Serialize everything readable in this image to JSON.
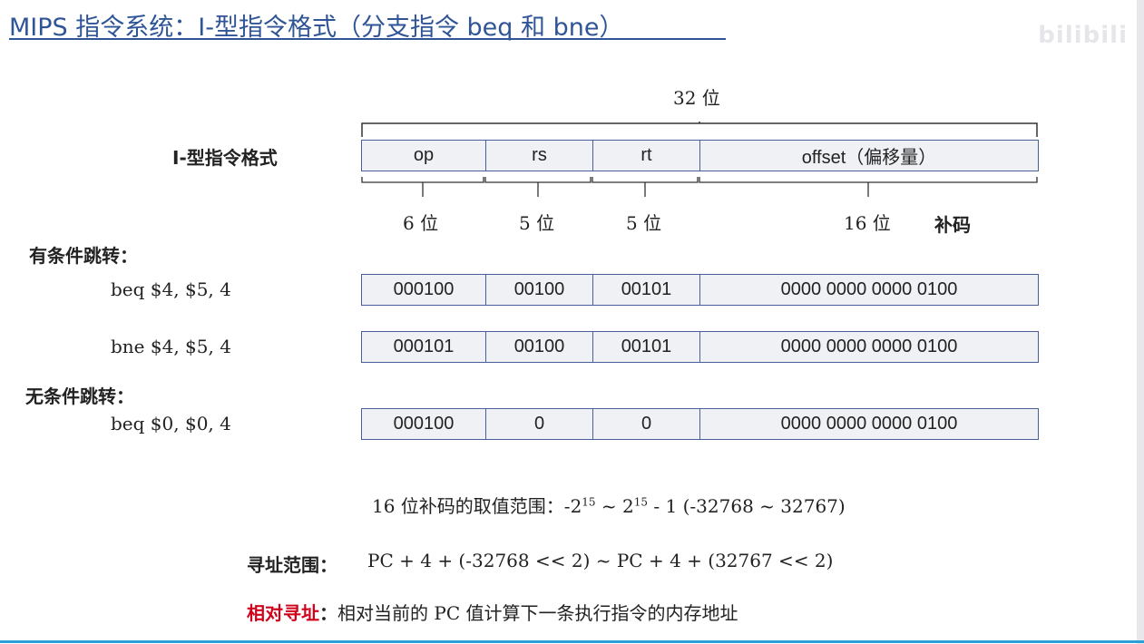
{
  "title": "MIPS 指令系统：I-型指令格式（分支指令 beq 和 bne）",
  "watermark": "bilibili",
  "format": {
    "total_label": "32 位",
    "row_label": "I-型指令格式",
    "fields": [
      "op",
      "rs",
      "rt",
      "offset（偏移量）"
    ],
    "widths": [
      "6 位",
      "5 位",
      "5 位",
      "16 位"
    ],
    "complement_note": "补码"
  },
  "conditional": {
    "heading": "有条件跳转：",
    "rows": [
      {
        "label": "beq $4, $5, 4",
        "cells": [
          "000100",
          "00100",
          "00101",
          "0000 0000 0000 0100"
        ]
      },
      {
        "label": "bne $4, $5, 4",
        "cells": [
          "000101",
          "00100",
          "00101",
          "0000 0000 0000 0100"
        ]
      }
    ]
  },
  "unconditional": {
    "heading": "无条件跳转：",
    "rows": [
      {
        "label": "beq $0, $0, 4",
        "cells": [
          "000100",
          "0",
          "0",
          "0000 0000 0000 0100"
        ]
      }
    ]
  },
  "range_text": {
    "prefix": "16 位补码的取值范围：-2",
    "exp1": "15",
    "mid": " ~ 2",
    "exp2": "15",
    "suffix": " - 1  (-32768 ~ 32767)"
  },
  "addressing": {
    "label": "寻址范围：",
    "value": "PC + 4 + (-32768 << 2) ~ PC + 4 + (32767 << 2)"
  },
  "relative": {
    "label": "相对寻址",
    "sep": "：",
    "value": "相对当前的 PC 值计算下一条执行指令的内存地址"
  },
  "colors": {
    "title": "#2f5597",
    "accent_red": "#d0021b",
    "cell_fill": "#f0f1f5",
    "cell_border": "#4a5f9a"
  }
}
